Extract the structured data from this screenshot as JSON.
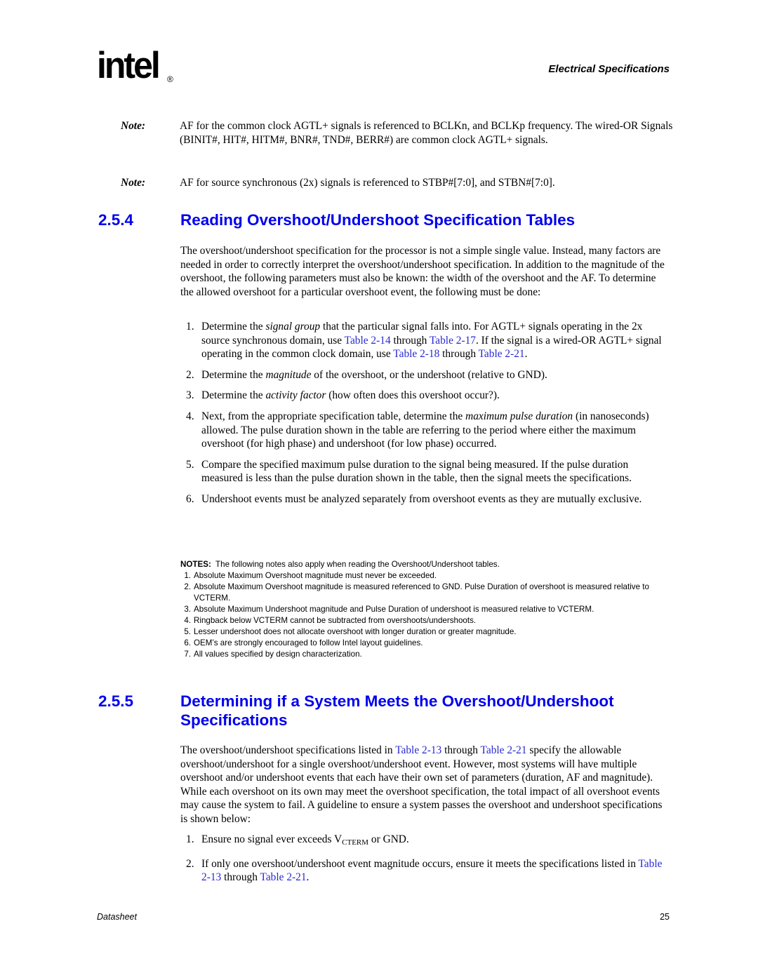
{
  "header": {
    "logo_text": "intel",
    "logo_mark": "®",
    "section_title": "Electrical Specifications"
  },
  "notes_top": [
    {
      "label": "Note:",
      "text": "AF for the common clock AGTL+ signals is referenced to BCLKn, and BCLKp frequency. The wired-OR Signals (BINIT#, HIT#, HITM#, BNR#, TND#, BERR#) are common clock AGTL+ signals."
    },
    {
      "label": "Note:",
      "text": "AF for source synchronous (2x) signals is referenced to STBP#[7:0], and STBN#[7:0]."
    }
  ],
  "section_254": {
    "number": "2.5.4",
    "title": "Reading Overshoot/Undershoot Specification Tables",
    "intro": "The overshoot/undershoot specification for the processor is not a simple single value. Instead, many factors are needed in order to correctly interpret the overshoot/undershoot specification. In addition to the magnitude of the overshoot, the following parameters must also be known: the width of the overshoot and the AF. To determine the allowed overshoot for a particular overshoot event, the following must be done:",
    "steps": {
      "s1": {
        "n": "1.",
        "a": "Determine the ",
        "em": "signal group",
        "b": " that the particular signal falls into. For AGTL+ signals operating in the 2x source synchronous domain, use ",
        "l1": "Table 2-14",
        "c": " through ",
        "l2": "Table 2-17",
        "d": ". If the signal is a wired-OR AGTL+ signal operating in the common clock domain, use ",
        "l3": "Table 2-18",
        "e": " through ",
        "l4": "Table 2-21",
        "f": "."
      },
      "s2": {
        "n": "2.",
        "a": "Determine the ",
        "em": "magnitude",
        "b": " of the overshoot, or the undershoot (relative to GND)."
      },
      "s3": {
        "n": "3.",
        "a": "Determine the ",
        "em": "activity factor",
        "b": " (how often does this overshoot occur?)."
      },
      "s4": {
        "n": "4.",
        "a": "Next, from the appropriate specification table, determine the ",
        "em": "maximum pulse duration",
        "b": " (in nanoseconds) allowed. The pulse duration shown in the table are referring to the period where either the maximum overshoot (for high phase) and undershoot (for low phase) occurred."
      },
      "s5": {
        "n": "5.",
        "text": "Compare the specified maximum pulse duration to the signal being measured. If the pulse duration measured is less than the pulse duration shown in the table, then the signal meets the specifications."
      },
      "s6": {
        "n": "6.",
        "text": "Undershoot events must be analyzed separately from overshoot events as they are mutually exclusive."
      }
    },
    "notes": {
      "label": "NOTES:",
      "intro": "The following notes also apply when reading the Overshoot/Undershoot tables.",
      "items": [
        {
          "n": "1.",
          "text": "Absolute Maximum Overshoot magnitude must never be exceeded."
        },
        {
          "n": "2.",
          "text": "Absolute Maximum Overshoot magnitude is measured referenced to GND. Pulse Duration of overshoot is measured relative to VCTERM."
        },
        {
          "n": "3.",
          "text": "Absolute Maximum Undershoot magnitude and Pulse Duration of undershoot is measured relative to VCTERM."
        },
        {
          "n": "4.",
          "text": "Ringback below VCTERM cannot be subtracted from overshoots/undershoots."
        },
        {
          "n": "5.",
          "text": "Lesser undershoot does not allocate overshoot with longer duration or greater magnitude."
        },
        {
          "n": "6.",
          "text": "OEM’s are strongly encouraged to follow Intel layout guidelines."
        },
        {
          "n": "7.",
          "text": "All values specified by design characterization."
        }
      ]
    }
  },
  "section_255": {
    "number": "2.5.5",
    "title": "Determining if a System Meets the Overshoot/Undershoot Specifications",
    "p_a": "The overshoot/undershoot specifications listed in ",
    "p_l1": "Table 2-13",
    "p_b": " through ",
    "p_l2": "Table 2-21",
    "p_c": " specify the allowable overshoot/undershoot for a single overshoot/undershoot event. However, most systems will have multiple overshoot and/or undershoot events that each have their own set of parameters (duration, AF and magnitude). While each overshoot on its own may meet the overshoot specification, the total impact of all overshoot events may cause the system to fail. A guideline to ensure a system passes the overshoot and undershoot specifications is shown below:",
    "steps": {
      "s1": {
        "n": "1.",
        "a": "Ensure no signal ever exceeds V",
        "sub": "CTERM",
        "b": " or GND."
      },
      "s2": {
        "n": "2.",
        "a": "If only one overshoot/undershoot event magnitude occurs, ensure it meets the specifications listed in ",
        "l1": "Table 2-13",
        "b": " through ",
        "l2": "Table 2-21",
        "c": "."
      }
    }
  },
  "footer": {
    "left": "Datasheet",
    "page_number": "25"
  }
}
